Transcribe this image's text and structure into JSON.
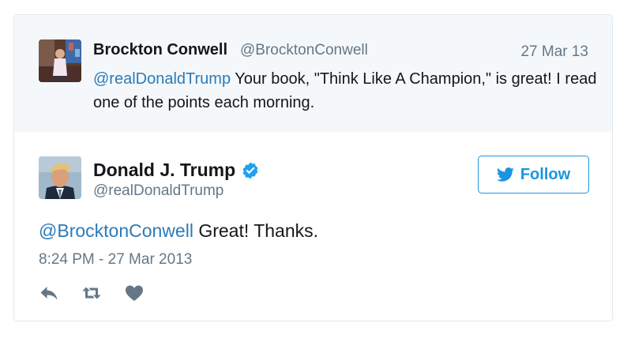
{
  "parent_tweet": {
    "author_name": "Brockton Conwell",
    "author_handle": "@BrocktonConwell",
    "date": "27 Mar 13",
    "mention": "@realDonaldTrump",
    "text": " Your book, \"Think Like A Champion,\" is great! I read one of the points each morning.",
    "avatar_icon": "profile-photo"
  },
  "main_tweet": {
    "author_name": "Donald J. Trump",
    "author_handle": "@realDonaldTrump",
    "verified_icon": "verified-badge-icon",
    "mention": "@BrocktonConwell",
    "text": " Great! Thanks.",
    "timestamp": "8:24 PM - 27 Mar 2013",
    "avatar_icon": "profile-photo"
  },
  "follow_button": {
    "label": "Follow",
    "icon": "twitter-bird-icon"
  },
  "actions": [
    {
      "name": "reply",
      "icon": "reply-icon"
    },
    {
      "name": "retweet",
      "icon": "retweet-icon"
    },
    {
      "name": "like",
      "icon": "heart-icon"
    }
  ],
  "colors": {
    "link": "#2b7bb9",
    "follow": "#1b95e0",
    "muted": "#657786",
    "verified": "#1da1f2",
    "icon": "#657786",
    "parent_bg": "#f5f8fa"
  }
}
